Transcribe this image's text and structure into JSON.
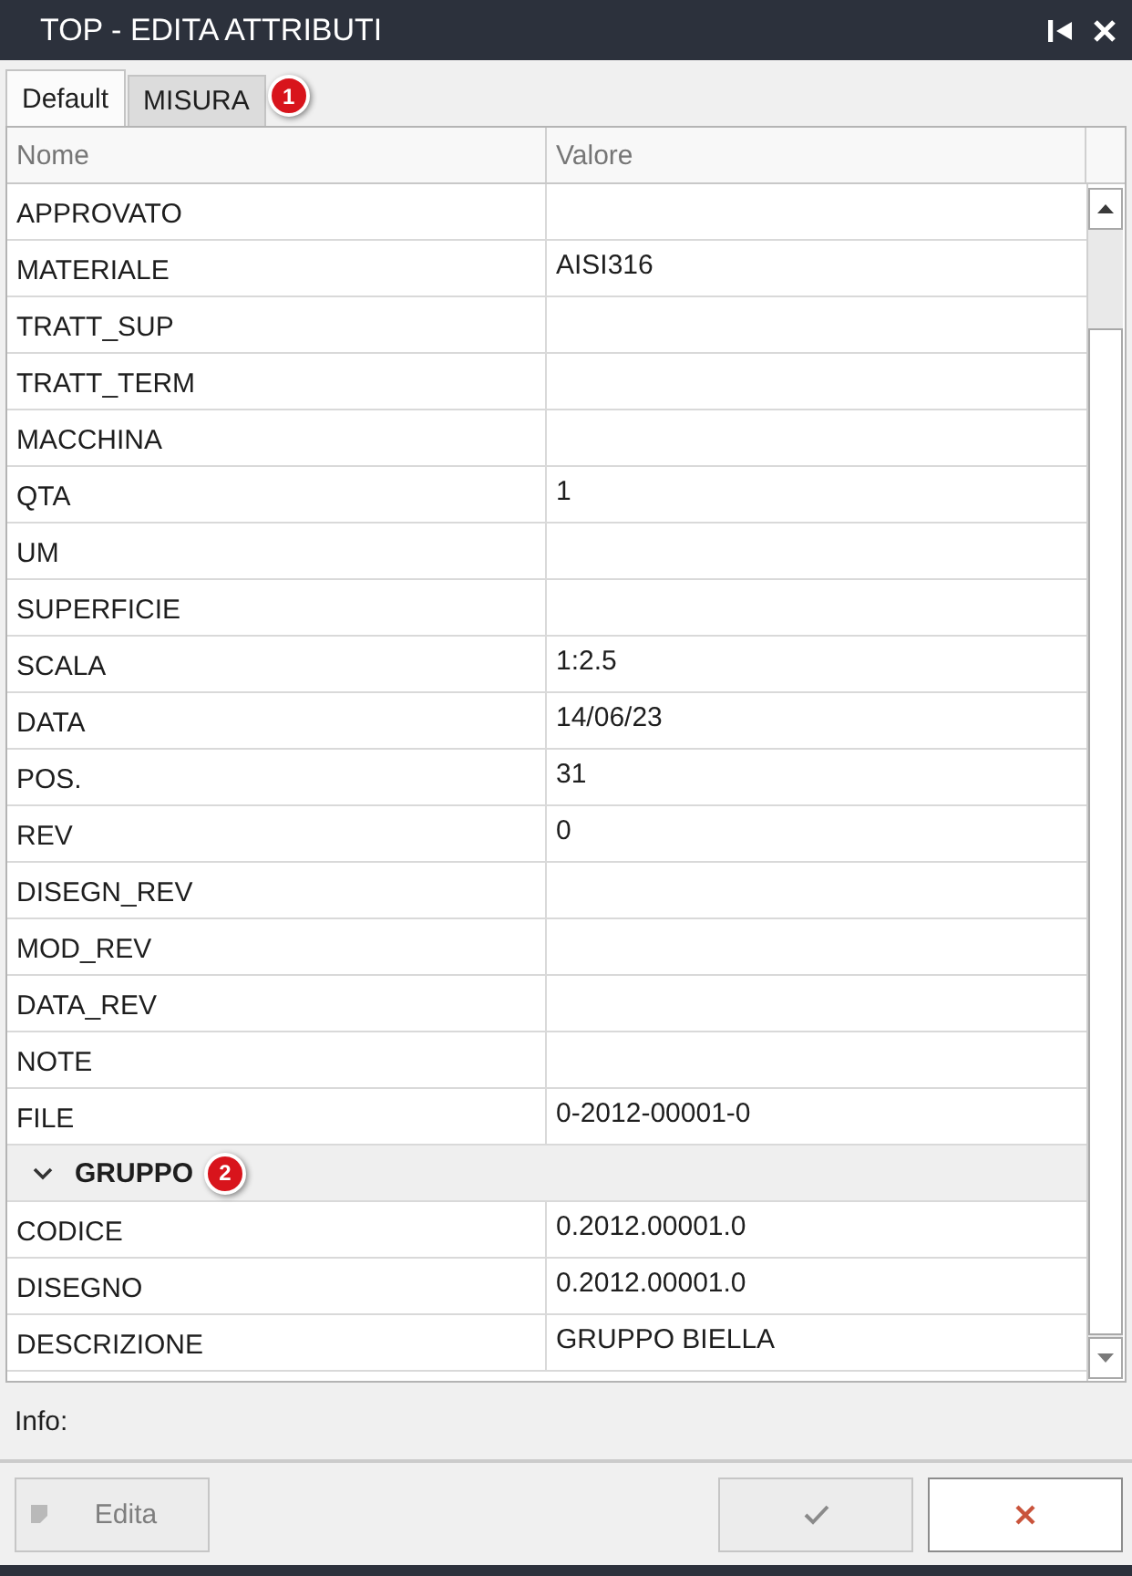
{
  "window": {
    "title": "TOP - EDITA ATTRIBUTI"
  },
  "tabs": [
    {
      "label": "Default",
      "selected": true
    },
    {
      "label": "MISURA",
      "selected": false,
      "annotation": "1"
    }
  ],
  "grid": {
    "columns": [
      "Nome",
      "Valore"
    ],
    "rows": [
      {
        "kind": "attribute",
        "name": "APPROVATO"
      },
      {
        "kind": "attribute",
        "name": "MATERIALE",
        "value": "AISI316"
      },
      {
        "kind": "attribute",
        "name": "TRATT_SUP"
      },
      {
        "kind": "attribute",
        "name": "TRATT_TERM"
      },
      {
        "kind": "attribute",
        "name": "MACCHINA"
      },
      {
        "kind": "attribute",
        "name": "QTA",
        "value": "1"
      },
      {
        "kind": "attribute",
        "name": "UM"
      },
      {
        "kind": "attribute",
        "name": "SUPERFICIE"
      },
      {
        "kind": "attribute",
        "name": "SCALA",
        "value": "1:2.5"
      },
      {
        "kind": "attribute",
        "name": "DATA",
        "value": "14/06/23"
      },
      {
        "kind": "attribute",
        "name": "POS.",
        "value": "31"
      },
      {
        "kind": "attribute",
        "name": "REV",
        "value": "0"
      },
      {
        "kind": "attribute",
        "name": "DISEGN_REV"
      },
      {
        "kind": "attribute",
        "name": "MOD_REV"
      },
      {
        "kind": "attribute",
        "name": "DATA_REV"
      },
      {
        "kind": "attribute",
        "name": "NOTE"
      },
      {
        "kind": "attribute",
        "name": "FILE",
        "value": "0-2012-00001-0"
      },
      {
        "kind": "group",
        "name": "GRUPPO",
        "expanded": true,
        "annotation": "2",
        "children": [
          {
            "kind": "attribute",
            "name": "CODICE",
            "value": "0.2012.00001.0"
          },
          {
            "kind": "attribute",
            "name": "DISEGNO",
            "value": "0.2012.00001.0"
          },
          {
            "kind": "attribute",
            "name": "DESCRIZIONE",
            "value": "GRUPPO BIELLA"
          }
        ]
      }
    ]
  },
  "info": {
    "label": "Info:"
  },
  "buttons": [
    {
      "kind": "edit",
      "label": "Edita",
      "disabled": true
    },
    {
      "kind": "confirm",
      "disabled": true
    },
    {
      "kind": "cancel",
      "disabled": false
    }
  ]
}
